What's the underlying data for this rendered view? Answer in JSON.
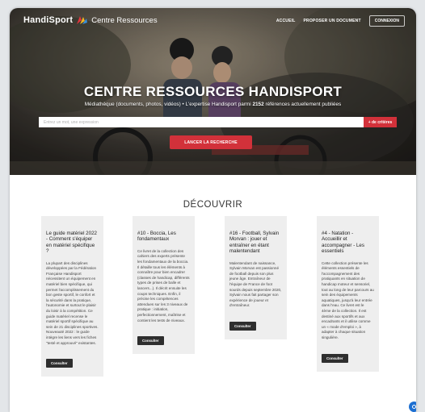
{
  "nav": {
    "logo_text": "HandiSport",
    "logo_sub": "Centre Ressources",
    "links": [
      "ACCUEIL",
      "PROPOSER UN DOCUMENT"
    ],
    "login_label": "CONNEXION"
  },
  "hero": {
    "title": "CENTRE RESSOURCES HANDISPORT",
    "subtitle_before": "Médiathèque (documents, photos, vidéos) • L'expertise Handisport parmi",
    "subtitle_count": "2152",
    "subtitle_after": "références actuellement publiées",
    "search_placeholder": "Entrez un mot, une expression",
    "criteria_label": "+ de critères",
    "launch_label": "LANCER LA RECHERCHE"
  },
  "discover": {
    "title": "DÉCOUVRIR",
    "cards": [
      {
        "title": "Le guide matériel 2022 - Comment s'équiper en matériel spécifique ?",
        "text": "La plupart des disciplines développées par la Fédération Française Handisport nécessitent un équipement en matériel bien spécifique, qui permet l'accomplissement du bon geste sportif, le confort et la sécurité dans la pratique, l'autonomie et surtout le plaisir du loisir à la compétition. Ce guide matériel recense le matériel sportif spécifique au sein de 21 disciplines sportives. Nouveauté 2022 : le guide intègre les liens vers les fiches \"testé et approuvé\" existantes.",
        "button": "Consulter"
      },
      {
        "title": "#10 - Boccia, Les fondamentaux",
        "text": "Ce livret de la collection des cahiers des experts présente les fondamentaux de la boccia. Il détaille tous les éléments à connaître pour bien encadrer (classes de handicap, différents types de prises de balle et lancers...). Il décrit ensuite les coups techniques. Enfin, il précise les compétences attendues sur les 3 niveaux de pratique : initiation, perfectionnement, maîtrise et contient les tests de niveaux.",
        "button": "Consulter"
      },
      {
        "title": "#16 - Football, Sylvain Morvan : jouer et entraîner en étant malentendant",
        "text": "Malentendant de naissance, Sylvain Morvan est passionné de football depuis son plus jeune âge. Entraîneur de l'équipe de France de foot sourds depuis septembre 2020, Sylvain nous fait partager son expérience de joueur et d'entraîneur.",
        "button": "Consulter"
      },
      {
        "title": "#4 - Natation - Accueillir et accompagner - Les essentiels",
        "text": "Cette collection présente les éléments essentiels de l'accompagnement des pratiquants en situation de handicap moteur et sensoriel, tout au long de leur parcours au sein des équipements aquatiques, jusqu'à leur entrée dans l'eau. Ce livret est le 4ème de la collection. Il est destiné aux sportifs et aux encadrants et il utilise comme un « mode d'emploi », à adapter à chaque situation singulière.",
        "button": "Consulter"
      }
    ]
  },
  "colors": {
    "accent": "#d2313a",
    "card_bg": "#eeeeee",
    "button_dark": "#2e2e2e",
    "chat": "#1d6fd1"
  },
  "icons": [
    "logo-mark-icon",
    "chat-icon"
  ]
}
